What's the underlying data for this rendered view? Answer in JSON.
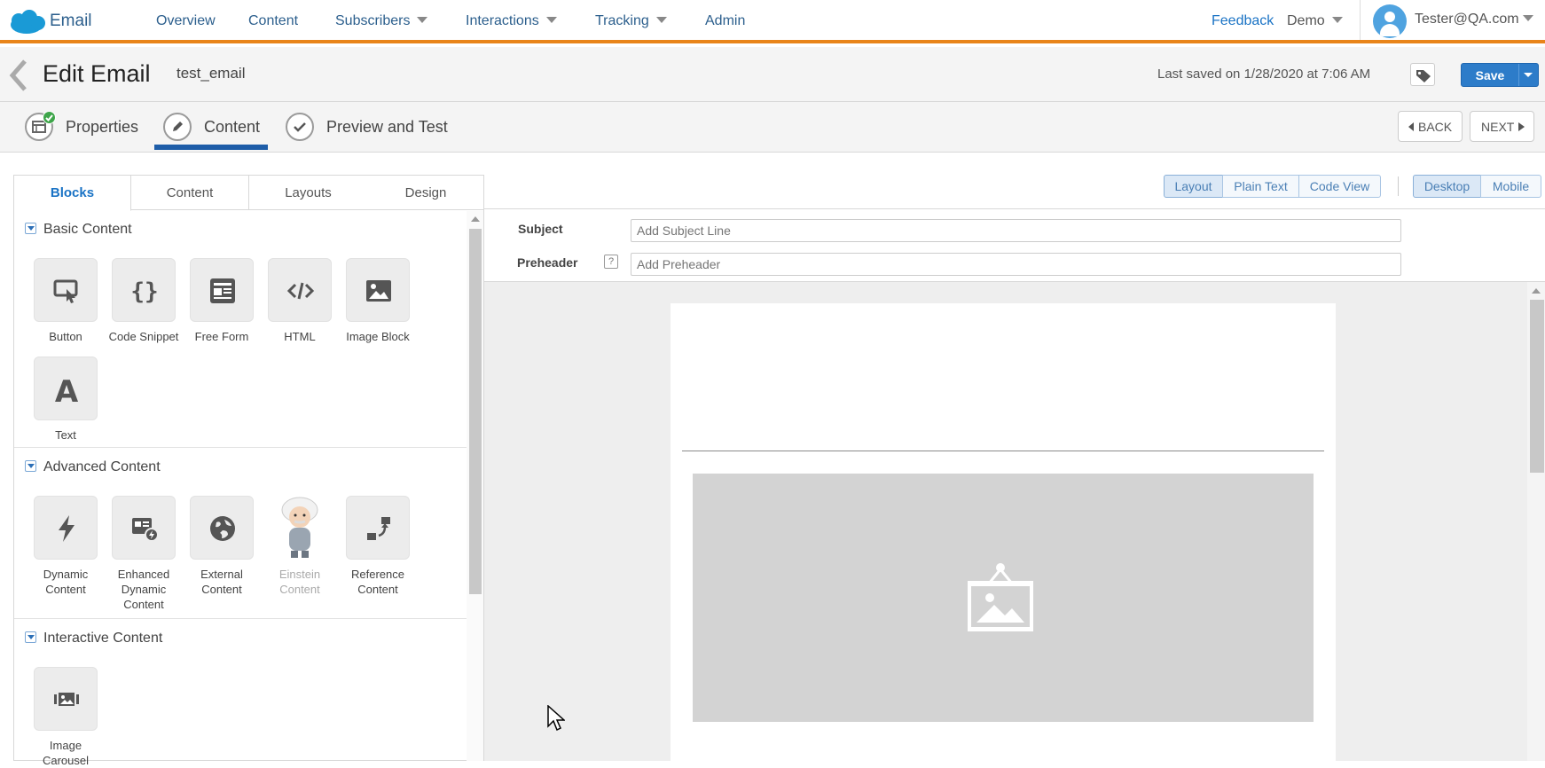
{
  "app": {
    "title": "Email"
  },
  "nav": {
    "items": [
      {
        "label": "Overview"
      },
      {
        "label": "Content"
      },
      {
        "label": "Subscribers"
      },
      {
        "label": "Interactions"
      },
      {
        "label": "Tracking"
      },
      {
        "label": "Admin"
      }
    ],
    "feedback": "Feedback",
    "account": "Demo",
    "user": "Tester@QA.com"
  },
  "header": {
    "title": "Edit Email",
    "email_name": "test_email",
    "last_saved": "Last saved on 1/28/2020 at 7:06 AM",
    "save_label": "Save"
  },
  "steps": {
    "items": [
      {
        "label": "Properties",
        "completed": true
      },
      {
        "label": "Content",
        "active": true
      },
      {
        "label": "Preview and Test"
      }
    ],
    "back_label": "BACK",
    "next_label": "NEXT"
  },
  "left_panel": {
    "tabs": [
      "Blocks",
      "Content",
      "Layouts",
      "Design"
    ],
    "active_tab": "Blocks",
    "sections": [
      {
        "title": "Basic Content",
        "blocks": [
          "Button",
          "Code Snippet",
          "Free Form",
          "HTML",
          "Image Block",
          "Text"
        ]
      },
      {
        "title": "Advanced Content",
        "blocks": [
          "Dynamic Content",
          "Enhanced Dynamic Content",
          "External Content",
          "Einstein Content",
          "Reference Content"
        ]
      },
      {
        "title": "Interactive Content",
        "blocks": [
          "Image Carousel"
        ]
      }
    ]
  },
  "toolbar": {
    "view_modes": [
      "Layout",
      "Plain Text",
      "Code View"
    ],
    "active_view_mode": "Layout",
    "devices": [
      "Desktop",
      "Mobile"
    ],
    "active_device": "Desktop"
  },
  "subject": {
    "subject_label": "Subject",
    "subject_placeholder": "Add Subject Line",
    "preheader_label": "Preheader",
    "preheader_placeholder": "Add Preheader",
    "help_glyph": "?"
  },
  "colors": {
    "accent_orange": "#e8841a",
    "primary_blue": "#2d7cc9",
    "nav_text": "#2c5f8d",
    "success_green": "#3ea54a"
  }
}
